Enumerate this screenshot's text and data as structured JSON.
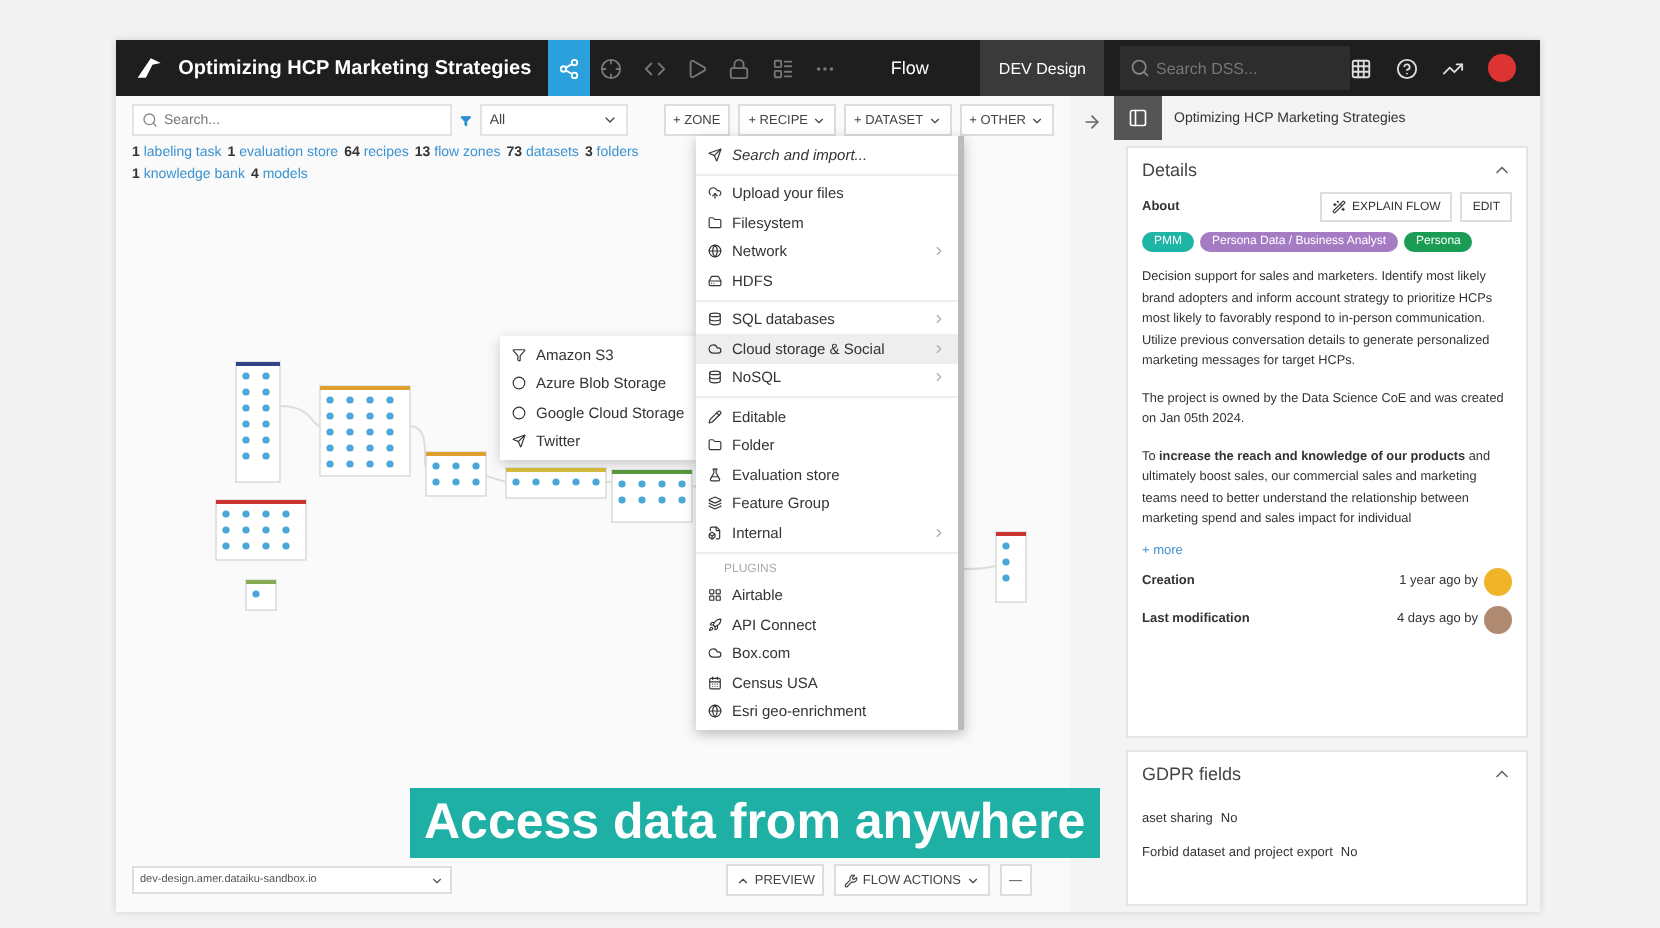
{
  "topbar": {
    "project_title": "Optimizing HCP Marketing Strategies",
    "nav_tabs": [
      {
        "selected": true
      },
      {
        "selected": false
      },
      {
        "selected": false
      },
      {
        "selected": false
      },
      {
        "selected": false
      },
      {
        "selected": false
      },
      {
        "selected": false
      }
    ],
    "section": "Flow",
    "instance": "DEV Design",
    "search": {
      "placeholder": "Search DSS..."
    }
  },
  "flow_toolbar": {
    "search": {
      "placeholder": "Search..."
    },
    "filter": {
      "value": "All"
    },
    "buttons": [
      {
        "label": "+ ZONE",
        "dropdown": false
      },
      {
        "label": "+ RECIPE",
        "dropdown": true
      },
      {
        "label": "+ DATASET",
        "dropdown": true
      },
      {
        "label": "+ OTHER",
        "dropdown": true
      }
    ]
  },
  "stats": [
    {
      "count": "1",
      "label": "labeling task"
    },
    {
      "count": "1",
      "label": "evaluation store"
    },
    {
      "count": "64",
      "label": "recipes"
    },
    {
      "count": "13",
      "label": "flow zones"
    },
    {
      "count": "73",
      "label": "datasets"
    },
    {
      "count": "3",
      "label": "folders"
    },
    {
      "count": "1",
      "label": "knowledge bank"
    },
    {
      "count": "4",
      "label": "models"
    }
  ],
  "dataset_menu": [
    {
      "kind": "action",
      "label": "Search and import...",
      "submenu": false,
      "highlighted": false
    },
    {
      "kind": "divider"
    },
    {
      "kind": "item",
      "label": "Upload your files",
      "submenu": false,
      "highlighted": false
    },
    {
      "kind": "item",
      "label": "Filesystem",
      "submenu": false,
      "highlighted": false
    },
    {
      "kind": "item",
      "label": "Network",
      "submenu": true,
      "highlighted": false
    },
    {
      "kind": "item",
      "label": "HDFS",
      "submenu": false,
      "highlighted": false
    },
    {
      "kind": "divider"
    },
    {
      "kind": "item",
      "label": "SQL databases",
      "submenu": true,
      "highlighted": false
    },
    {
      "kind": "item",
      "label": "Cloud storage & Social",
      "submenu": true,
      "highlighted": true
    },
    {
      "kind": "item",
      "label": "NoSQL",
      "submenu": true,
      "highlighted": false
    },
    {
      "kind": "divider"
    },
    {
      "kind": "item",
      "label": "Editable",
      "submenu": false,
      "highlighted": false
    },
    {
      "kind": "item",
      "label": "Folder",
      "submenu": false,
      "highlighted": false
    },
    {
      "kind": "item",
      "label": "Evaluation store",
      "submenu": false,
      "highlighted": false
    },
    {
      "kind": "item",
      "label": "Feature Group",
      "submenu": false,
      "highlighted": false
    },
    {
      "kind": "item",
      "label": "Internal",
      "submenu": true,
      "highlighted": false
    },
    {
      "kind": "divider"
    },
    {
      "kind": "header",
      "label": "PLUGINS"
    },
    {
      "kind": "item",
      "label": "Airtable",
      "submenu": false,
      "highlighted": false
    },
    {
      "kind": "item",
      "label": "API Connect",
      "submenu": false,
      "highlighted": false
    },
    {
      "kind": "item",
      "label": "Box.com",
      "submenu": false,
      "highlighted": false
    },
    {
      "kind": "item",
      "label": "Census USA",
      "submenu": false,
      "highlighted": false
    },
    {
      "kind": "item",
      "label": "Esri geo-enrichment",
      "submenu": false,
      "highlighted": false
    }
  ],
  "cloud_submenu": [
    "Amazon S3",
    "Azure Blob Storage",
    "Google Cloud Storage",
    "Twitter"
  ],
  "footer": {
    "host": "dev-design.amer.dataiku-sandbox.io",
    "buttons": [
      "PREVIEW",
      "FLOW ACTIONS",
      "—"
    ]
  },
  "right_panel": {
    "title": "Optimizing HCP Marketing Strategies",
    "details": {
      "title": "Details",
      "expanded": true,
      "about_label": "About",
      "buttons": [
        "EXPLAIN FLOW",
        "EDIT"
      ],
      "tags": [
        {
          "label": "PMM",
          "color": "#1fb5a6"
        },
        {
          "label": "Persona Data / Business Analyst",
          "color": "#a57cc4"
        },
        {
          "label": "Persona",
          "color": "#1a9c55"
        }
      ],
      "description": [
        "Decision support for sales and marketers. Identify most likely brand adopters and inform account strategy to prioritize HCPs most likely to favorably respond to in-person communication. Utilize previous conversation details to generate personalized marketing messages for target HCPs.",
        "The project is owned by the Data Science CoE and was created on Jan 05th 2024.",
        "To **increase the reach and knowledge of our products** and ultimately boost sales, our commercial sales and marketing teams need to better understand the relationship between marketing spend and sales impact for individual"
      ],
      "more_link": "+ more",
      "meta": [
        {
          "label": "Creation",
          "value": "1 year ago by",
          "kind": "initial"
        },
        {
          "label": "Last modification",
          "value": "4 days ago by",
          "kind": "photo"
        }
      ]
    },
    "gdpr": {
      "title": "GDPR fields",
      "expanded": true,
      "rows": [
        {
          "label": "aset sharing",
          "value": "No"
        },
        {
          "label": "Forbid dataset and project export",
          "value": "No"
        }
      ]
    }
  },
  "caption": "Access data from anywhere"
}
